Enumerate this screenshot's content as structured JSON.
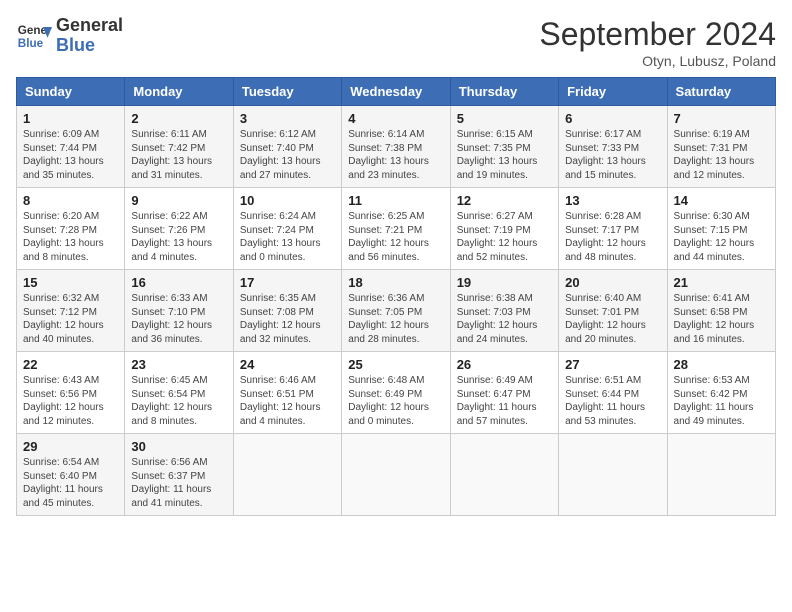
{
  "header": {
    "logo_line1": "General",
    "logo_line2": "Blue",
    "month_title": "September 2024",
    "location": "Otyn, Lubusz, Poland"
  },
  "weekdays": [
    "Sunday",
    "Monday",
    "Tuesday",
    "Wednesday",
    "Thursday",
    "Friday",
    "Saturday"
  ],
  "weeks": [
    [
      {
        "day": "1",
        "info": "Sunrise: 6:09 AM\nSunset: 7:44 PM\nDaylight: 13 hours\nand 35 minutes."
      },
      {
        "day": "2",
        "info": "Sunrise: 6:11 AM\nSunset: 7:42 PM\nDaylight: 13 hours\nand 31 minutes."
      },
      {
        "day": "3",
        "info": "Sunrise: 6:12 AM\nSunset: 7:40 PM\nDaylight: 13 hours\nand 27 minutes."
      },
      {
        "day": "4",
        "info": "Sunrise: 6:14 AM\nSunset: 7:38 PM\nDaylight: 13 hours\nand 23 minutes."
      },
      {
        "day": "5",
        "info": "Sunrise: 6:15 AM\nSunset: 7:35 PM\nDaylight: 13 hours\nand 19 minutes."
      },
      {
        "day": "6",
        "info": "Sunrise: 6:17 AM\nSunset: 7:33 PM\nDaylight: 13 hours\nand 15 minutes."
      },
      {
        "day": "7",
        "info": "Sunrise: 6:19 AM\nSunset: 7:31 PM\nDaylight: 13 hours\nand 12 minutes."
      }
    ],
    [
      {
        "day": "8",
        "info": "Sunrise: 6:20 AM\nSunset: 7:28 PM\nDaylight: 13 hours\nand 8 minutes."
      },
      {
        "day": "9",
        "info": "Sunrise: 6:22 AM\nSunset: 7:26 PM\nDaylight: 13 hours\nand 4 minutes."
      },
      {
        "day": "10",
        "info": "Sunrise: 6:24 AM\nSunset: 7:24 PM\nDaylight: 13 hours\nand 0 minutes."
      },
      {
        "day": "11",
        "info": "Sunrise: 6:25 AM\nSunset: 7:21 PM\nDaylight: 12 hours\nand 56 minutes."
      },
      {
        "day": "12",
        "info": "Sunrise: 6:27 AM\nSunset: 7:19 PM\nDaylight: 12 hours\nand 52 minutes."
      },
      {
        "day": "13",
        "info": "Sunrise: 6:28 AM\nSunset: 7:17 PM\nDaylight: 12 hours\nand 48 minutes."
      },
      {
        "day": "14",
        "info": "Sunrise: 6:30 AM\nSunset: 7:15 PM\nDaylight: 12 hours\nand 44 minutes."
      }
    ],
    [
      {
        "day": "15",
        "info": "Sunrise: 6:32 AM\nSunset: 7:12 PM\nDaylight: 12 hours\nand 40 minutes."
      },
      {
        "day": "16",
        "info": "Sunrise: 6:33 AM\nSunset: 7:10 PM\nDaylight: 12 hours\nand 36 minutes."
      },
      {
        "day": "17",
        "info": "Sunrise: 6:35 AM\nSunset: 7:08 PM\nDaylight: 12 hours\nand 32 minutes."
      },
      {
        "day": "18",
        "info": "Sunrise: 6:36 AM\nSunset: 7:05 PM\nDaylight: 12 hours\nand 28 minutes."
      },
      {
        "day": "19",
        "info": "Sunrise: 6:38 AM\nSunset: 7:03 PM\nDaylight: 12 hours\nand 24 minutes."
      },
      {
        "day": "20",
        "info": "Sunrise: 6:40 AM\nSunset: 7:01 PM\nDaylight: 12 hours\nand 20 minutes."
      },
      {
        "day": "21",
        "info": "Sunrise: 6:41 AM\nSunset: 6:58 PM\nDaylight: 12 hours\nand 16 minutes."
      }
    ],
    [
      {
        "day": "22",
        "info": "Sunrise: 6:43 AM\nSunset: 6:56 PM\nDaylight: 12 hours\nand 12 minutes."
      },
      {
        "day": "23",
        "info": "Sunrise: 6:45 AM\nSunset: 6:54 PM\nDaylight: 12 hours\nand 8 minutes."
      },
      {
        "day": "24",
        "info": "Sunrise: 6:46 AM\nSunset: 6:51 PM\nDaylight: 12 hours\nand 4 minutes."
      },
      {
        "day": "25",
        "info": "Sunrise: 6:48 AM\nSunset: 6:49 PM\nDaylight: 12 hours\nand 0 minutes."
      },
      {
        "day": "26",
        "info": "Sunrise: 6:49 AM\nSunset: 6:47 PM\nDaylight: 11 hours\nand 57 minutes."
      },
      {
        "day": "27",
        "info": "Sunrise: 6:51 AM\nSunset: 6:44 PM\nDaylight: 11 hours\nand 53 minutes."
      },
      {
        "day": "28",
        "info": "Sunrise: 6:53 AM\nSunset: 6:42 PM\nDaylight: 11 hours\nand 49 minutes."
      }
    ],
    [
      {
        "day": "29",
        "info": "Sunrise: 6:54 AM\nSunset: 6:40 PM\nDaylight: 11 hours\nand 45 minutes."
      },
      {
        "day": "30",
        "info": "Sunrise: 6:56 AM\nSunset: 6:37 PM\nDaylight: 11 hours\nand 41 minutes."
      },
      null,
      null,
      null,
      null,
      null
    ]
  ]
}
